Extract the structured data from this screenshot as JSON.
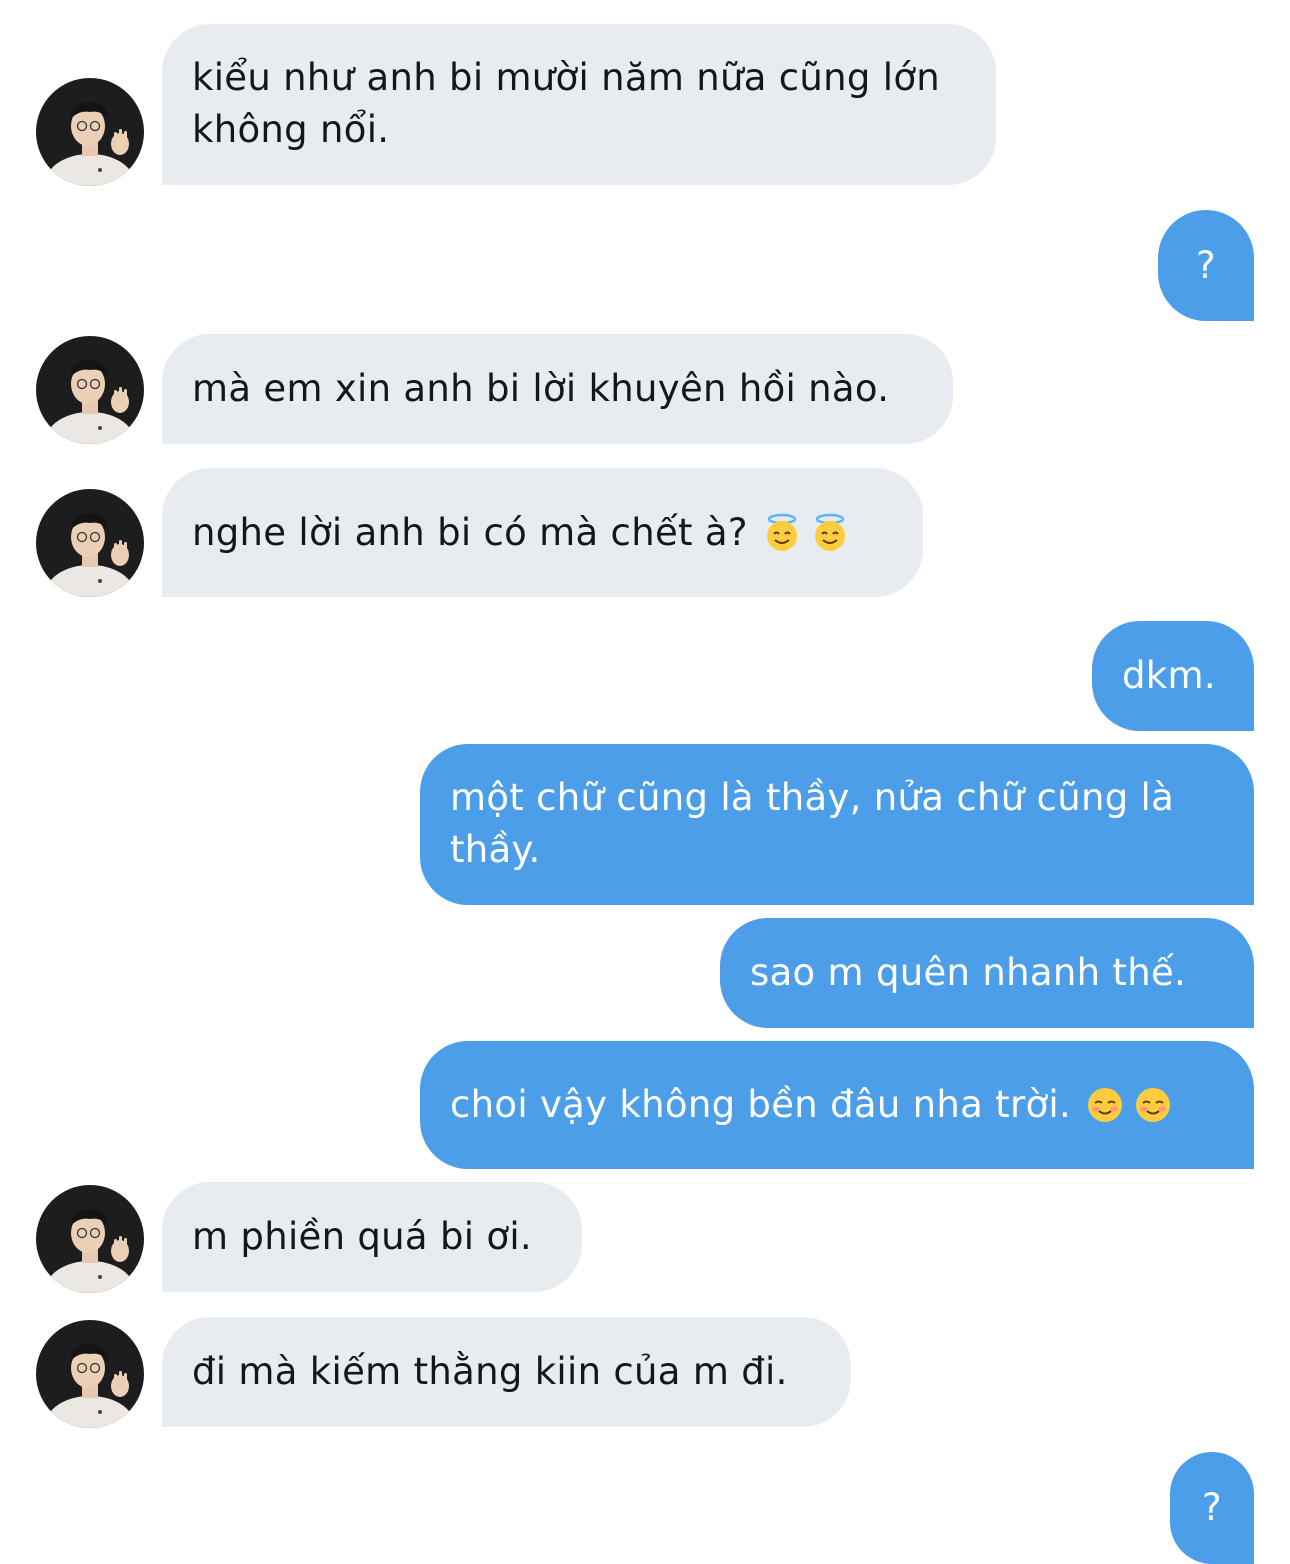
{
  "colors": {
    "incoming_bubble": "#e8ecf0",
    "outgoing_bubble": "#4c9ee9",
    "incoming_text": "#14171a",
    "outgoing_text": "#ffffff"
  },
  "messages": [
    {
      "direction": "in",
      "text": "kiểu như anh bi mười năm nữa cũng lớn không nổi.",
      "avatar": "profile-photo"
    },
    {
      "direction": "out",
      "text": "?"
    },
    {
      "direction": "in",
      "text": "mà em xin anh bi lời khuyên hồi nào.",
      "avatar": "profile-photo"
    },
    {
      "direction": "in",
      "text": "nghe lời anh bi có mà chết à?",
      "emojis": [
        "smiling-face-with-halo",
        "smiling-face-with-halo"
      ],
      "avatar": "profile-photo"
    },
    {
      "direction": "out",
      "text": "dkm."
    },
    {
      "direction": "out",
      "text": "một chữ cũng là thầy, nửa chữ cũng là thầy."
    },
    {
      "direction": "out",
      "text": "sao m quên nhanh thế."
    },
    {
      "direction": "out",
      "text": "choi vậy không bền đâu nha trời.",
      "emojis": [
        "smiling-face",
        "smiling-face"
      ]
    },
    {
      "direction": "in",
      "text": "m phiền quá bi ơi.",
      "avatar": "profile-photo"
    },
    {
      "direction": "in",
      "text": "đi mà kiếm thằng kiin của m đi.",
      "avatar": "profile-photo"
    },
    {
      "direction": "out",
      "text": "?"
    }
  ]
}
